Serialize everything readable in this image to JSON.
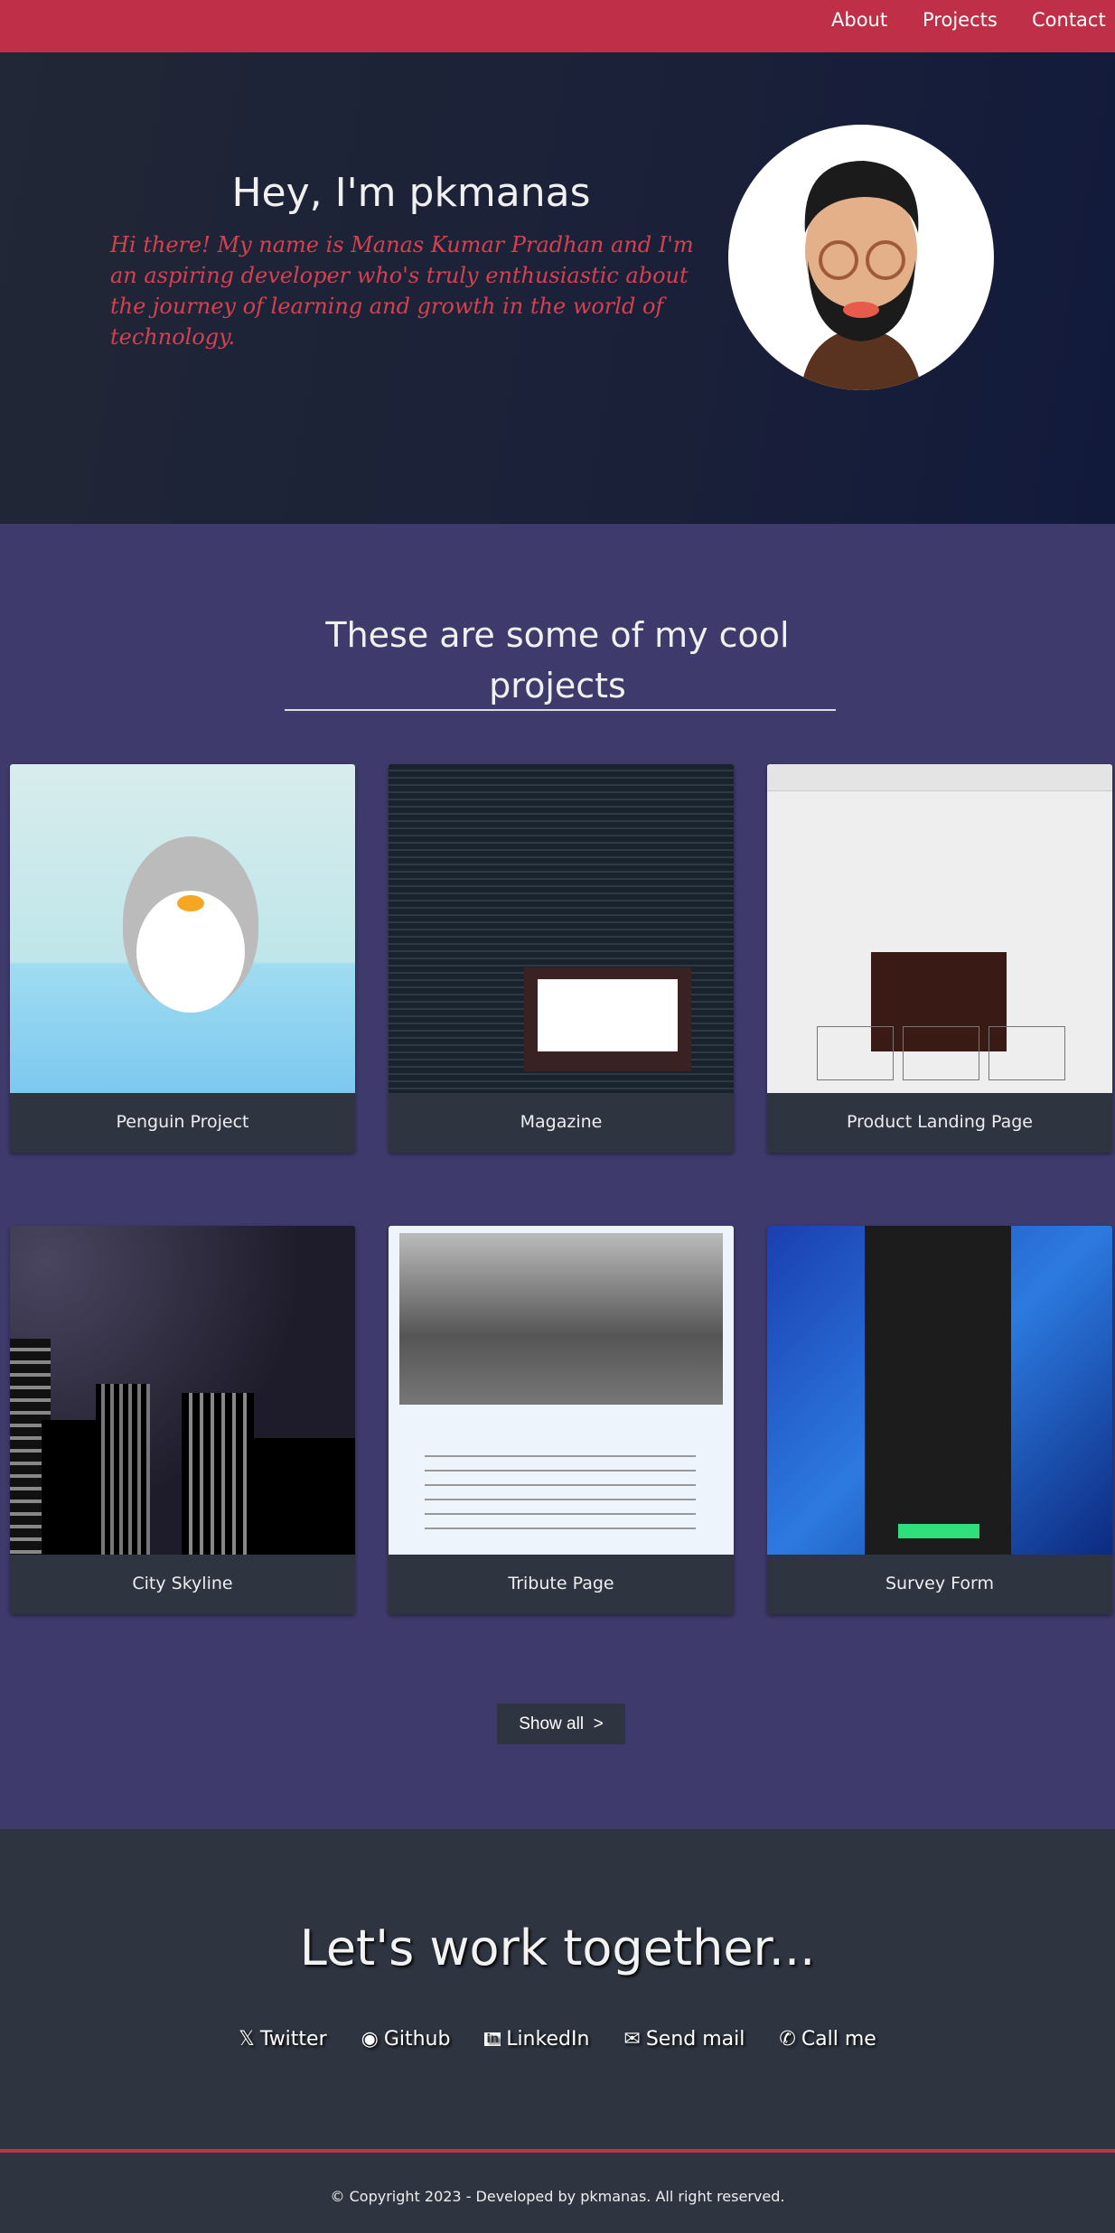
{
  "nav": {
    "items": [
      "About",
      "Projects",
      "Contact"
    ]
  },
  "hero": {
    "title": "Hey, I'm pkmanas",
    "intro": "Hi there! My name is Manas Kumar Pradhan and I'm an aspiring developer who's truly enthusiastic about the journey of learning and growth in the world of technology."
  },
  "projects": {
    "heading": "These are some of my cool projects",
    "cards": [
      {
        "title": "Penguin Project"
      },
      {
        "title": "Magazine"
      },
      {
        "title": "Product Landing Page"
      },
      {
        "title": "City Skyline"
      },
      {
        "title": "Tribute Page"
      },
      {
        "title": "Survey Form"
      }
    ],
    "show_all": "Show all",
    "show_all_icon": "chevron-right-icon"
  },
  "contact": {
    "heading": "Let's work together...",
    "links": [
      {
        "label": "Twitter",
        "icon": "x-icon"
      },
      {
        "label": "Github",
        "icon": "github-icon"
      },
      {
        "label": "LinkedIn",
        "icon": "linkedin-icon"
      },
      {
        "label": "Send mail",
        "icon": "mail-icon"
      },
      {
        "label": "Call me",
        "icon": "phone-icon"
      }
    ]
  },
  "footer": {
    "text": "© Copyright 2023 - Developed by pkmanas. All right reserved."
  },
  "colors": {
    "nav": "#bf3048",
    "projects_bg": "#3e3a6b",
    "dark": "#2f3540",
    "intro": "#d6404f"
  }
}
